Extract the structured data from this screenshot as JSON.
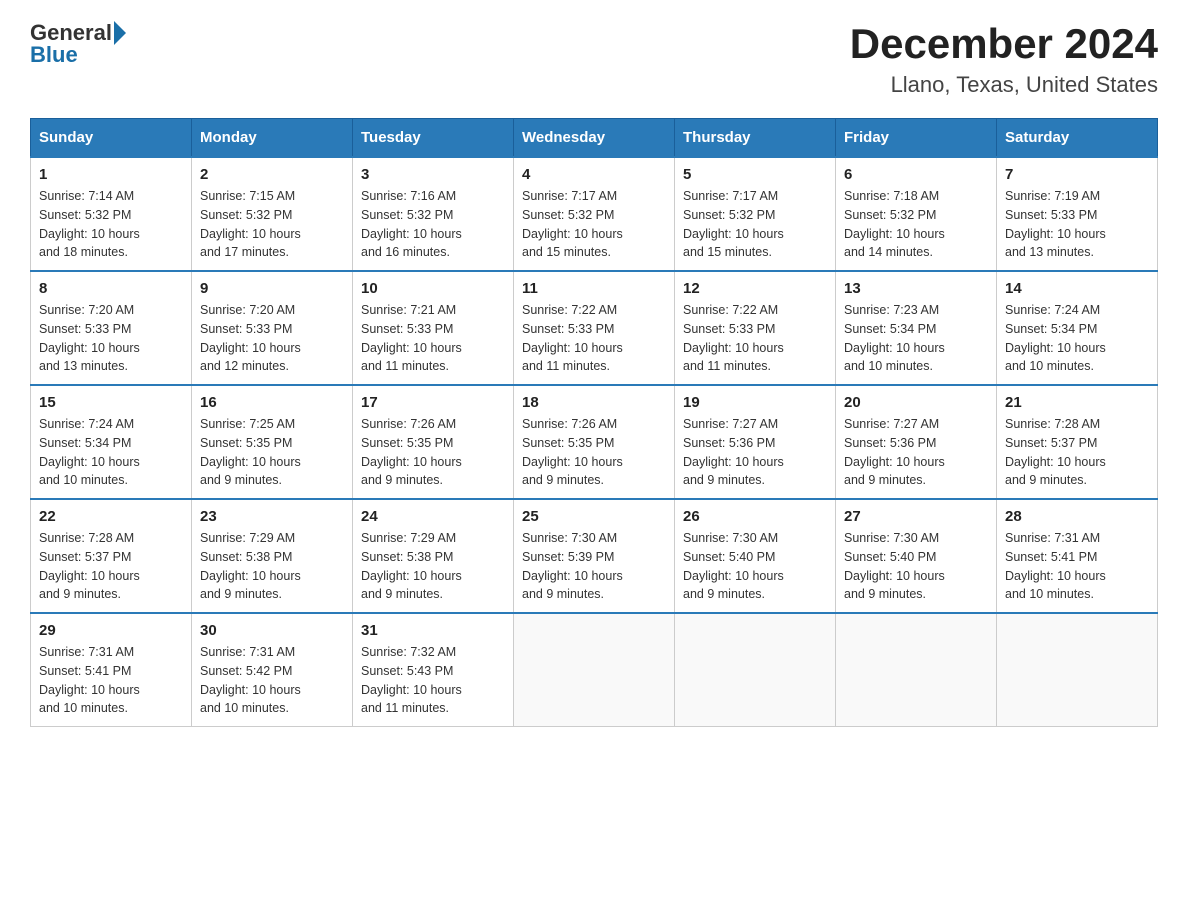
{
  "header": {
    "logo": {
      "text_before": "General",
      "text_after": "Blue"
    },
    "title": "December 2024",
    "location": "Llano, Texas, United States"
  },
  "days_of_week": [
    "Sunday",
    "Monday",
    "Tuesday",
    "Wednesday",
    "Thursday",
    "Friday",
    "Saturday"
  ],
  "weeks": [
    [
      {
        "num": "1",
        "sunrise": "7:14 AM",
        "sunset": "5:32 PM",
        "daylight": "10 hours and 18 minutes."
      },
      {
        "num": "2",
        "sunrise": "7:15 AM",
        "sunset": "5:32 PM",
        "daylight": "10 hours and 17 minutes."
      },
      {
        "num": "3",
        "sunrise": "7:16 AM",
        "sunset": "5:32 PM",
        "daylight": "10 hours and 16 minutes."
      },
      {
        "num": "4",
        "sunrise": "7:17 AM",
        "sunset": "5:32 PM",
        "daylight": "10 hours and 15 minutes."
      },
      {
        "num": "5",
        "sunrise": "7:17 AM",
        "sunset": "5:32 PM",
        "daylight": "10 hours and 15 minutes."
      },
      {
        "num": "6",
        "sunrise": "7:18 AM",
        "sunset": "5:32 PM",
        "daylight": "10 hours and 14 minutes."
      },
      {
        "num": "7",
        "sunrise": "7:19 AM",
        "sunset": "5:33 PM",
        "daylight": "10 hours and 13 minutes."
      }
    ],
    [
      {
        "num": "8",
        "sunrise": "7:20 AM",
        "sunset": "5:33 PM",
        "daylight": "10 hours and 13 minutes."
      },
      {
        "num": "9",
        "sunrise": "7:20 AM",
        "sunset": "5:33 PM",
        "daylight": "10 hours and 12 minutes."
      },
      {
        "num": "10",
        "sunrise": "7:21 AM",
        "sunset": "5:33 PM",
        "daylight": "10 hours and 11 minutes."
      },
      {
        "num": "11",
        "sunrise": "7:22 AM",
        "sunset": "5:33 PM",
        "daylight": "10 hours and 11 minutes."
      },
      {
        "num": "12",
        "sunrise": "7:22 AM",
        "sunset": "5:33 PM",
        "daylight": "10 hours and 11 minutes."
      },
      {
        "num": "13",
        "sunrise": "7:23 AM",
        "sunset": "5:34 PM",
        "daylight": "10 hours and 10 minutes."
      },
      {
        "num": "14",
        "sunrise": "7:24 AM",
        "sunset": "5:34 PM",
        "daylight": "10 hours and 10 minutes."
      }
    ],
    [
      {
        "num": "15",
        "sunrise": "7:24 AM",
        "sunset": "5:34 PM",
        "daylight": "10 hours and 10 minutes."
      },
      {
        "num": "16",
        "sunrise": "7:25 AM",
        "sunset": "5:35 PM",
        "daylight": "10 hours and 9 minutes."
      },
      {
        "num": "17",
        "sunrise": "7:26 AM",
        "sunset": "5:35 PM",
        "daylight": "10 hours and 9 minutes."
      },
      {
        "num": "18",
        "sunrise": "7:26 AM",
        "sunset": "5:35 PM",
        "daylight": "10 hours and 9 minutes."
      },
      {
        "num": "19",
        "sunrise": "7:27 AM",
        "sunset": "5:36 PM",
        "daylight": "10 hours and 9 minutes."
      },
      {
        "num": "20",
        "sunrise": "7:27 AM",
        "sunset": "5:36 PM",
        "daylight": "10 hours and 9 minutes."
      },
      {
        "num": "21",
        "sunrise": "7:28 AM",
        "sunset": "5:37 PM",
        "daylight": "10 hours and 9 minutes."
      }
    ],
    [
      {
        "num": "22",
        "sunrise": "7:28 AM",
        "sunset": "5:37 PM",
        "daylight": "10 hours and 9 minutes."
      },
      {
        "num": "23",
        "sunrise": "7:29 AM",
        "sunset": "5:38 PM",
        "daylight": "10 hours and 9 minutes."
      },
      {
        "num": "24",
        "sunrise": "7:29 AM",
        "sunset": "5:38 PM",
        "daylight": "10 hours and 9 minutes."
      },
      {
        "num": "25",
        "sunrise": "7:30 AM",
        "sunset": "5:39 PM",
        "daylight": "10 hours and 9 minutes."
      },
      {
        "num": "26",
        "sunrise": "7:30 AM",
        "sunset": "5:40 PM",
        "daylight": "10 hours and 9 minutes."
      },
      {
        "num": "27",
        "sunrise": "7:30 AM",
        "sunset": "5:40 PM",
        "daylight": "10 hours and 9 minutes."
      },
      {
        "num": "28",
        "sunrise": "7:31 AM",
        "sunset": "5:41 PM",
        "daylight": "10 hours and 10 minutes."
      }
    ],
    [
      {
        "num": "29",
        "sunrise": "7:31 AM",
        "sunset": "5:41 PM",
        "daylight": "10 hours and 10 minutes."
      },
      {
        "num": "30",
        "sunrise": "7:31 AM",
        "sunset": "5:42 PM",
        "daylight": "10 hours and 10 minutes."
      },
      {
        "num": "31",
        "sunrise": "7:32 AM",
        "sunset": "5:43 PM",
        "daylight": "10 hours and 11 minutes."
      },
      null,
      null,
      null,
      null
    ]
  ],
  "labels": {
    "sunrise": "Sunrise:",
    "sunset": "Sunset:",
    "daylight": "Daylight:"
  }
}
